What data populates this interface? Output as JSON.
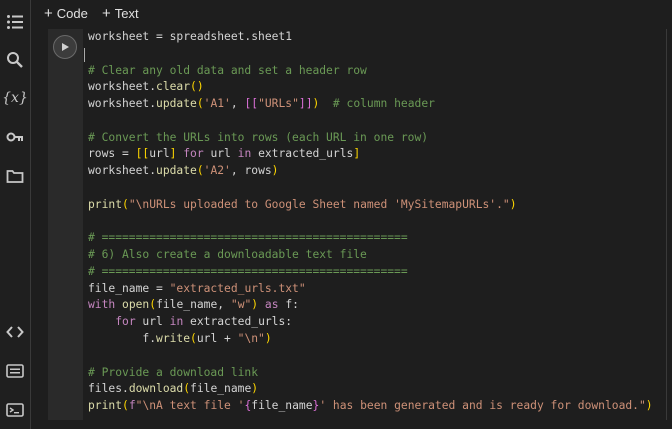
{
  "toolbar": {
    "code_label": "Code",
    "text_label": "Text"
  },
  "sidebar": {
    "icons": [
      "table-of-contents-icon",
      "search-icon",
      "variables-icon",
      "secrets-key-icon",
      "files-folder-icon",
      "code-snippets-icon",
      "command-palette-icon",
      "terminal-icon"
    ],
    "variables_label": "{x}"
  },
  "cell": {
    "lines": [
      [
        [
          "def",
          "worksheet = spreadsheet.sheet1"
        ]
      ],
      [],
      [
        [
          "com",
          "# Clear any old data and set a header row"
        ]
      ],
      [
        [
          "def",
          "worksheet."
        ],
        [
          "fn",
          "clear"
        ],
        [
          "br",
          "()"
        ]
      ],
      [
        [
          "def",
          "worksheet."
        ],
        [
          "fn",
          "update"
        ],
        [
          "br",
          "("
        ],
        [
          "str",
          "'A1'"
        ],
        [
          "def",
          ", "
        ],
        [
          "br2",
          "[["
        ],
        [
          "str",
          "\"URLs\""
        ],
        [
          "br2",
          "]]"
        ],
        [
          "br",
          ")"
        ],
        [
          "def",
          "  "
        ],
        [
          "com",
          "# column header"
        ]
      ],
      [],
      [
        [
          "com",
          "# Convert the URLs into rows (each URL in one row)"
        ]
      ],
      [
        [
          "def",
          "rows = "
        ],
        [
          "br",
          "[["
        ],
        [
          "def",
          "url"
        ],
        [
          "br",
          "]"
        ],
        [
          "def",
          " "
        ],
        [
          "kw",
          "for"
        ],
        [
          "def",
          " url "
        ],
        [
          "kw",
          "in"
        ],
        [
          "def",
          " extracted_urls"
        ],
        [
          "br",
          "]"
        ]
      ],
      [
        [
          "def",
          "worksheet."
        ],
        [
          "fn",
          "update"
        ],
        [
          "br",
          "("
        ],
        [
          "str",
          "'A2'"
        ],
        [
          "def",
          ", rows"
        ],
        [
          "br",
          ")"
        ]
      ],
      [],
      [
        [
          "fn",
          "print"
        ],
        [
          "br",
          "("
        ],
        [
          "str",
          "\"\\nURLs uploaded to Google Sheet named 'MySitemapURLs'.\""
        ],
        [
          "br",
          ")"
        ]
      ],
      [],
      [
        [
          "com",
          "# ============================================="
        ]
      ],
      [
        [
          "com",
          "# 6) Also create a downloadable text file"
        ]
      ],
      [
        [
          "com",
          "# ============================================="
        ]
      ],
      [
        [
          "def",
          "file_name = "
        ],
        [
          "str",
          "\"extracted_urls.txt\""
        ]
      ],
      [
        [
          "kw",
          "with"
        ],
        [
          "def",
          " "
        ],
        [
          "fn",
          "open"
        ],
        [
          "br",
          "("
        ],
        [
          "def",
          "file_name, "
        ],
        [
          "str",
          "\"w\""
        ],
        [
          "br",
          ")"
        ],
        [
          "def",
          " "
        ],
        [
          "kw",
          "as"
        ],
        [
          "def",
          " f:"
        ]
      ],
      [
        [
          "def",
          "    "
        ],
        [
          "kw",
          "for"
        ],
        [
          "def",
          " url "
        ],
        [
          "kw",
          "in"
        ],
        [
          "def",
          " extracted_urls:"
        ]
      ],
      [
        [
          "def",
          "        f."
        ],
        [
          "fn",
          "write"
        ],
        [
          "br",
          "("
        ],
        [
          "def",
          "url + "
        ],
        [
          "str",
          "\"\\n\""
        ],
        [
          "br",
          ")"
        ]
      ],
      [],
      [
        [
          "com",
          "# Provide a download link"
        ]
      ],
      [
        [
          "def",
          "files."
        ],
        [
          "fn",
          "download"
        ],
        [
          "br",
          "("
        ],
        [
          "def",
          "file_name"
        ],
        [
          "br",
          ")"
        ]
      ],
      [
        [
          "fn",
          "print"
        ],
        [
          "br",
          "("
        ],
        [
          "kw",
          "f"
        ],
        [
          "str",
          "\"\\nA text file '"
        ],
        [
          "br2",
          "{"
        ],
        [
          "def",
          "file_name"
        ],
        [
          "br2",
          "}"
        ],
        [
          "str",
          "' has been generated and is ready for download.\""
        ],
        [
          "br",
          ")"
        ]
      ]
    ]
  }
}
